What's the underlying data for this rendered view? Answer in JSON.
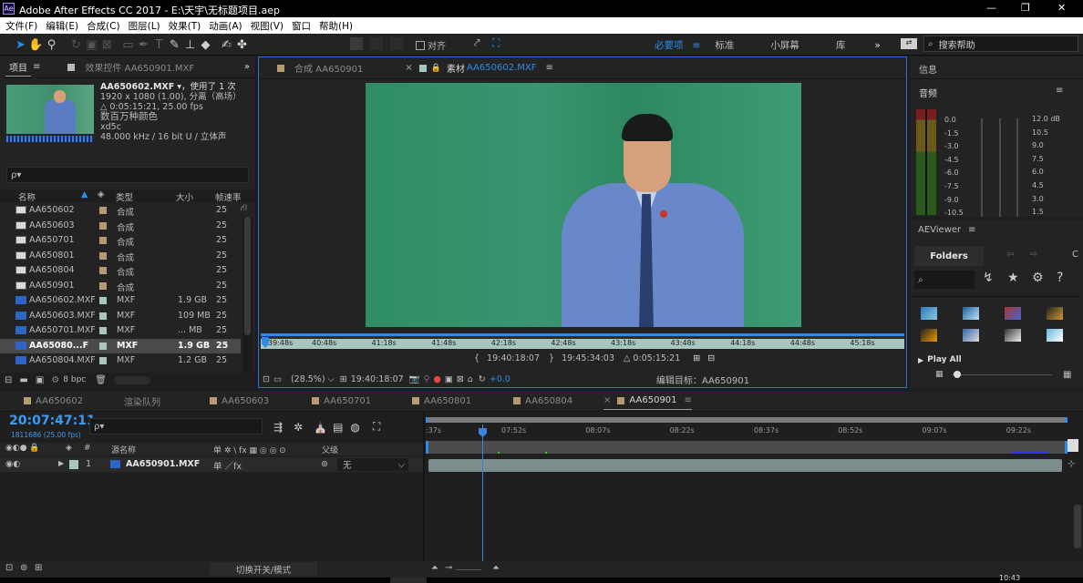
{
  "titlebar": {
    "logo": "Ae",
    "title": "Adobe After Effects CC 2017 - E:\\天宇\\无标题项目.aep",
    "controls": [
      "—",
      "❐",
      "✕"
    ]
  },
  "menu": [
    "文件(F)",
    "编辑(E)",
    "合成(C)",
    "图层(L)",
    "效果(T)",
    "动画(A)",
    "视图(V)",
    "窗口",
    "帮助(H)"
  ],
  "toolbar": {
    "align_label": "对齐",
    "workspaces": [
      "必要项",
      "标准",
      "小屏幕",
      "库"
    ],
    "more": "»",
    "search_placeholder": "搜索帮助"
  },
  "project": {
    "tab_project": "项目",
    "tab_effects": "效果控件 AA650901.MXF",
    "file_name": "AA650602.MXF",
    "used": "▾，使用了 1 次",
    "info_lines": [
      "1920 x 1080 (1.00), 分离（高场）",
      "△ 0:05:15:21, 25.00 fps",
      "数百万种颜色",
      "xd5c",
      "48.000 kHz / 16 bit U / 立体声"
    ],
    "search_placeholder": "ρ▾",
    "headers": {
      "name": "名称",
      "type": "类型",
      "size": "大小",
      "fps": "帧速率"
    },
    "rows": [
      {
        "name": "AA650602",
        "type": "合成",
        "size": "",
        "fps": "25",
        "kind": "comp",
        "color": "#b59a72"
      },
      {
        "name": "AA650603",
        "type": "合成",
        "size": "",
        "fps": "25",
        "kind": "comp",
        "color": "#b59a72"
      },
      {
        "name": "AA650701",
        "type": "合成",
        "size": "",
        "fps": "25",
        "kind": "comp",
        "color": "#b59a72"
      },
      {
        "name": "AA650801",
        "type": "合成",
        "size": "",
        "fps": "25",
        "kind": "comp",
        "color": "#b59a72"
      },
      {
        "name": "AA650804",
        "type": "合成",
        "size": "",
        "fps": "25",
        "kind": "comp",
        "color": "#b59a72"
      },
      {
        "name": "AA650901",
        "type": "合成",
        "size": "",
        "fps": "25",
        "kind": "comp",
        "color": "#b59a72"
      },
      {
        "name": "AA650602.MXF",
        "type": "MXF",
        "size": "1.9 GB",
        "fps": "25",
        "kind": "mxf",
        "color": "#a6c7c0"
      },
      {
        "name": "AA650603.MXF",
        "type": "MXF",
        "size": "109 MB",
        "fps": "25",
        "kind": "mxf",
        "color": "#a6c7c0"
      },
      {
        "name": "AA650701.MXF",
        "type": "MXF",
        "size": "... MB",
        "fps": "25",
        "kind": "mxf",
        "color": "#a6c7c0"
      },
      {
        "name": "AA65080...F",
        "type": "MXF",
        "size": "1.9 GB",
        "fps": "25",
        "kind": "mxf",
        "color": "#a6c7c0",
        "selected": true
      },
      {
        "name": "AA650804.MXF",
        "type": "MXF",
        "size": "1.2 GB",
        "fps": "25",
        "kind": "mxf",
        "color": "#a6c7c0"
      }
    ],
    "bpc": "8 bpc"
  },
  "viewer": {
    "tab_comp": "合成 AA650901",
    "tab_footage_prefix": "素材",
    "tab_footage_name": "AA650602.MXF",
    "ruler": [
      "39:48s",
      "40:48s",
      "41:18s",
      "41:48s",
      "42:18s",
      "42:48s",
      "43:18s",
      "43:48s",
      "44:18s",
      "44:48s",
      "45:18s"
    ],
    "in_point": "19:40:18:07",
    "out_point": "19:45:34:03",
    "duration": "△ 0:05:15:21",
    "zoom": "(28.5%)",
    "current_time": "19:40:18:07",
    "exposure": "+0.0",
    "edit_target": "编辑目标：AA650901"
  },
  "info": {
    "tab": "信息",
    "audio_tab": "音频",
    "levels_left": [
      "0.0",
      "-1.5",
      "-3.0",
      "-4.5",
      "-6.0",
      "-7.5",
      "-9.0",
      "-10.5"
    ],
    "levels_right": [
      "12.0 dB",
      "10.5",
      "9.0",
      "7.5",
      "6.0",
      "4.5",
      "3.0",
      "1.5"
    ]
  },
  "aeviewer": {
    "tab": "AEViewer",
    "folders": "Folders",
    "more": "C",
    "play_all": "Play All"
  },
  "timeline": {
    "tabs": [
      "AA650602",
      "渲染队列",
      "AA650603",
      "AA650701",
      "AA650801",
      "AA650804",
      "AA650901"
    ],
    "timecode": "20:07:47:11",
    "frames": "1811686 (25.00 fps)",
    "search_placeholder": "ρ▾",
    "col_source": "源名称",
    "col_switches": "单 ✲ \\ fx ▦ ◎ ◎ ⊙",
    "col_parent": "父级",
    "layer": {
      "num": "1",
      "name": "AA650901.MXF",
      "switches": "单 ／fx",
      "parent": "无"
    },
    "ruler": [
      ":37s",
      "07:52s",
      "08:07s",
      "08:22s",
      "08:37s",
      "08:52s",
      "09:07s",
      "09:22s"
    ],
    "toggle_label": "切换开关/模式"
  },
  "taskbar": {
    "clock": "10:43"
  }
}
